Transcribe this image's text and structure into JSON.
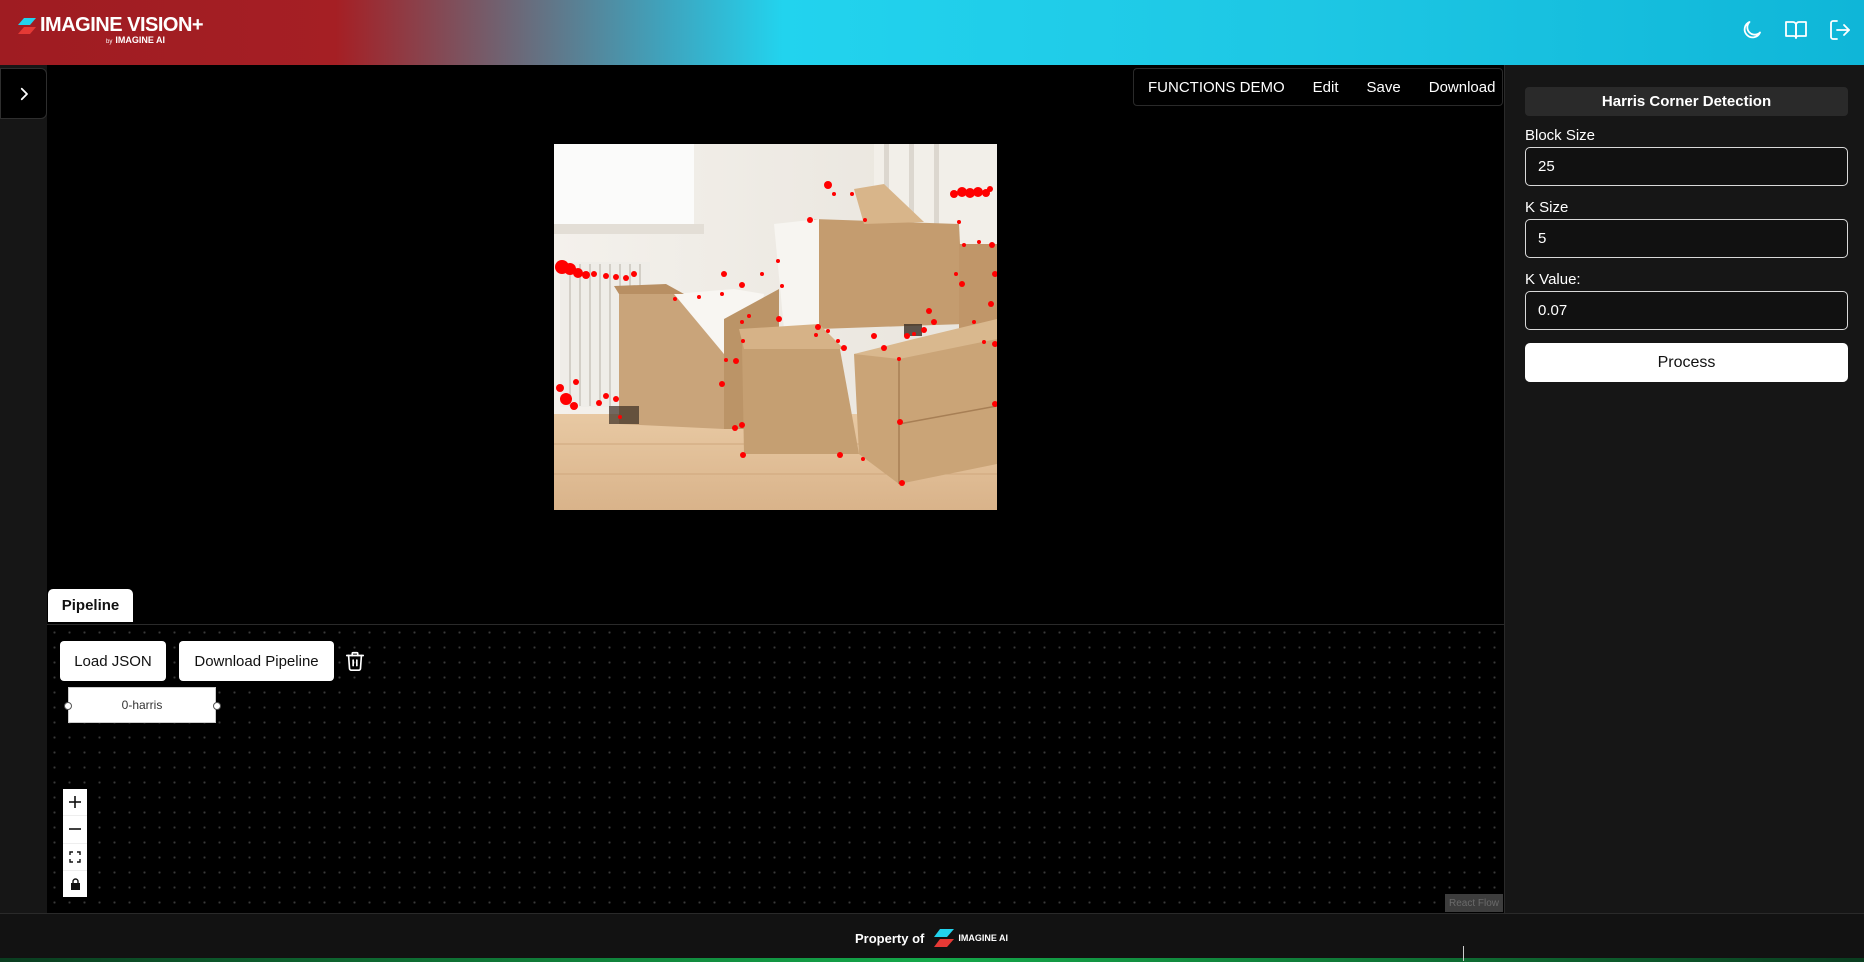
{
  "header": {
    "brand": "IMAGINE VISION+",
    "brand_by": "by",
    "brand_company": "IMAGINE AI",
    "icons": [
      "moon-icon",
      "book-icon",
      "logout-icon"
    ]
  },
  "menubar": {
    "items": [
      "FUNCTIONS DEMO",
      "Edit",
      "Save",
      "Download"
    ]
  },
  "panel": {
    "title": "Harris Corner Detection",
    "block_size_label": "Block Size",
    "block_size_value": "25",
    "k_size_label": "K Size",
    "k_size_value": "5",
    "k_value_label": "K Value:",
    "k_value_value": "0.07",
    "process_label": "Process"
  },
  "pipeline": {
    "tab_label": "Pipeline",
    "load_json_label": "Load JSON",
    "download_pipeline_label": "Download Pipeline",
    "node_label": "0-harris",
    "attribution": "React Flow"
  },
  "footer": {
    "property_of": "Property of",
    "company": "IMAGINE AI"
  },
  "colors": {
    "header_red": "#a51f24",
    "header_cyan": "#22d3ee",
    "corner_marker": "#ff0000",
    "panel_bg": "#161616"
  }
}
